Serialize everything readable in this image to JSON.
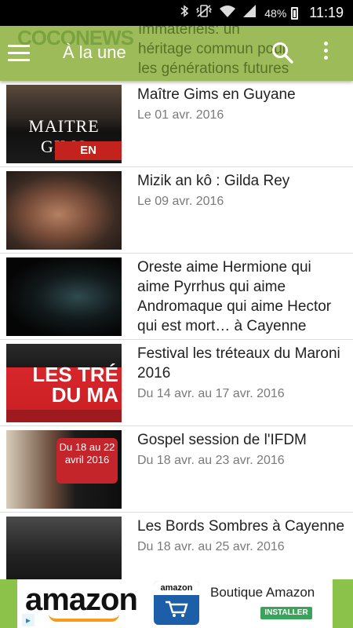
{
  "status_bar": {
    "icons": [
      "bluetooth-icon",
      "vibrate-icon",
      "wifi-icon",
      "signal-icon"
    ],
    "battery": "48%",
    "time": "11:19"
  },
  "app_bar": {
    "logo_text": "COCONEWS",
    "scrolled_text": "Immatériels: un héritage commun pour les générations futures",
    "title": "À la une",
    "icons": {
      "menu": "hamburger-menu-icon",
      "search": "search-icon",
      "more": "more-vert-icon"
    }
  },
  "articles": [
    {
      "title": "Maître Gims en Guyane",
      "date": "Le 01 avr. 2016",
      "thumb_text": "MAITRE GIMS",
      "thumb_badge": "EN CONCERT"
    },
    {
      "title": "Mizik an kô : Gilda Rey",
      "date": "Le 09 avr. 2016"
    },
    {
      "title": "Oreste aime Hermione qui aime Pyrrhus qui aime Andromaque qui aime Hector qui est mort… à Cayenne",
      "date": ""
    },
    {
      "title": "Festival les tréteaux du Maroni 2016",
      "date": "Du 14 avr. au 17 avr. 2016",
      "thumb_text": "LES TRÉ DU MA"
    },
    {
      "title": "Gospel session de l'IFDM",
      "date": "Du 18 avr. au 23 avr. 2016",
      "thumb_text": "Du 18 au 22 avril 2016"
    },
    {
      "title": "Les Bords Sombres à Cayenne",
      "date": "Du 18 avr. au 25 avr. 2016"
    }
  ],
  "ad": {
    "brand": "amazon",
    "app_icon_label": "amazon",
    "text": "Boutique Amazon",
    "button": "INSTALLER",
    "adchoices_icon": "adchoices-icon"
  },
  "colors": {
    "app_bar": "#9ebb5a",
    "status_bar": "#000000",
    "ad_side": "#8bc34a",
    "install_button": "#3aa55a"
  }
}
